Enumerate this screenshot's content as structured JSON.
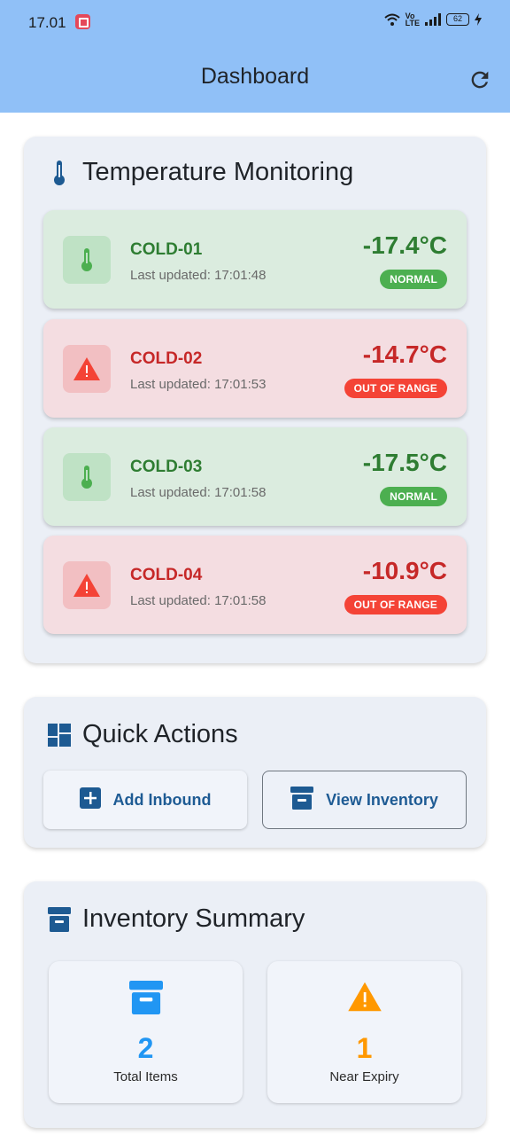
{
  "status_bar": {
    "time": "17.01",
    "battery": "62"
  },
  "app_bar": {
    "title": "Dashboard",
    "refresh_icon": "refresh-icon"
  },
  "temperature": {
    "title": "Temperature Monitoring",
    "sensors": [
      {
        "id": "COLD-01",
        "updated": "Last updated: 17:01:48",
        "temp": "-17.4°C",
        "status": "NORMAL",
        "state": "ok"
      },
      {
        "id": "COLD-02",
        "updated": "Last updated: 17:01:53",
        "temp": "-14.7°C",
        "status": "OUT OF RANGE",
        "state": "bad"
      },
      {
        "id": "COLD-03",
        "updated": "Last updated: 17:01:58",
        "temp": "-17.5°C",
        "status": "NORMAL",
        "state": "ok"
      },
      {
        "id": "COLD-04",
        "updated": "Last updated: 17:01:58",
        "temp": "-10.9°C",
        "status": "OUT OF RANGE",
        "state": "bad"
      }
    ]
  },
  "quick_actions": {
    "title": "Quick Actions",
    "add_inbound": "Add Inbound",
    "view_inventory": "View Inventory"
  },
  "inventory_summary": {
    "title": "Inventory Summary",
    "total_items": {
      "value": "2",
      "label": "Total Items"
    },
    "near_expiry": {
      "value": "1",
      "label": "Near Expiry"
    }
  },
  "colors": {
    "app_bar": "#90c0f7",
    "normal": "#2e7d32",
    "alert": "#c62828",
    "brand_blue": "#1e5b94",
    "total_items": "#2196f3",
    "near_expiry": "#ff9800"
  }
}
